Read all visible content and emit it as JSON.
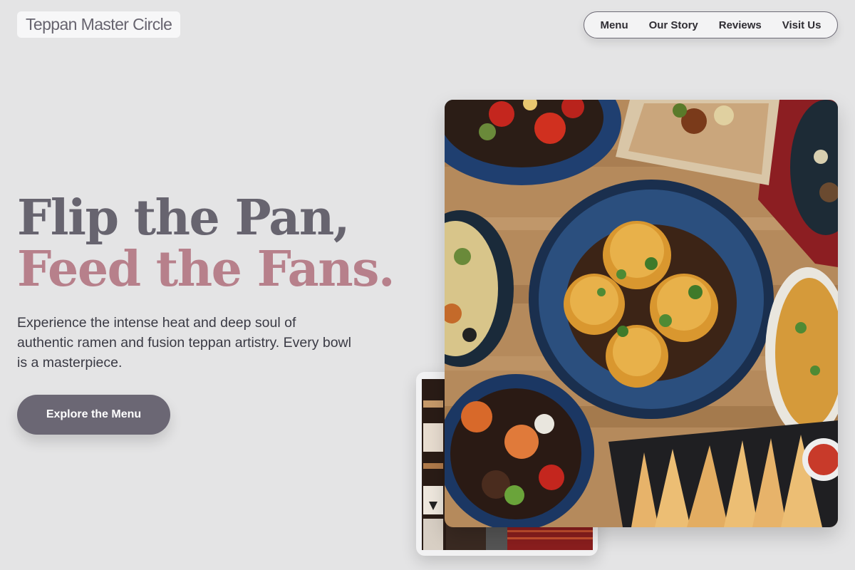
{
  "brand": {
    "name": "Teppan Master Circle"
  },
  "nav": {
    "items": [
      {
        "label": "Menu"
      },
      {
        "label": "Our Story"
      },
      {
        "label": "Reviews"
      },
      {
        "label": "Visit Us"
      }
    ]
  },
  "hero": {
    "headline_line1": "Flip the Pan,",
    "headline_line2": "Feed the Fans.",
    "description": "Experience the intense heat and deep soul of authentic ramen and fusion teppan artistry. Every bowl is a masterpiece.",
    "cta_label": "Explore the Menu"
  },
  "colors": {
    "background": "#e4e4e5",
    "headline_primary": "#67646f",
    "headline_accent": "#b7808b",
    "button": "#6b6774"
  },
  "images": {
    "main": "food-spread-photo",
    "secondary": "restaurant-interior-photo"
  }
}
